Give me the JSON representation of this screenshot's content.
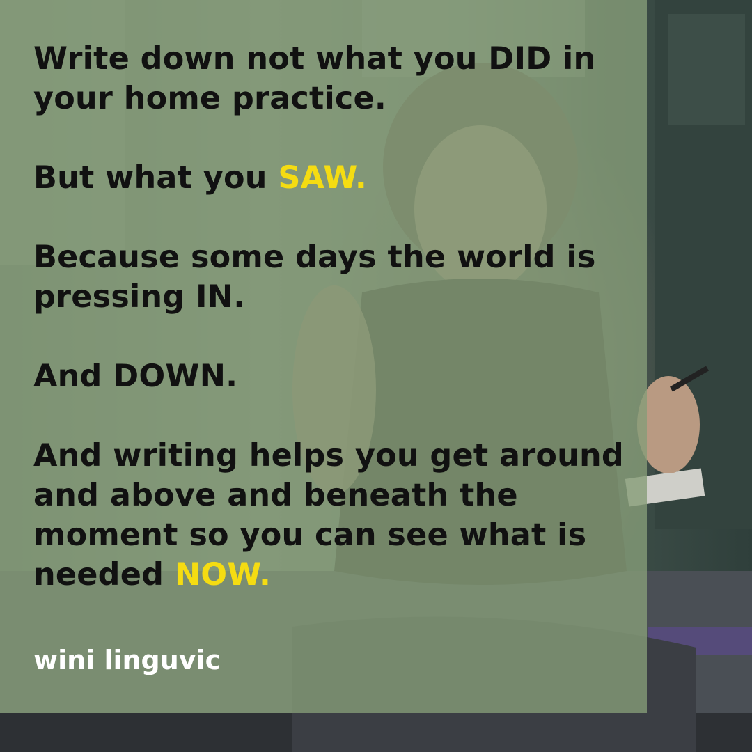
{
  "post": {
    "paragraphs": [
      {
        "lines": [
          "Write down not what you DID in",
          "your home practice."
        ]
      },
      {
        "lead": "But what you ",
        "highlight": "SAW."
      },
      {
        "lines": [
          "Because some days the world is",
          "pressing IN."
        ]
      },
      {
        "lines": [
          "And DOWN."
        ]
      },
      {
        "lines": [
          "And writing helps you get around",
          "and above and beneath the",
          "moment so you can see what is"
        ],
        "last_lead": "needed ",
        "highlight": "NOW."
      }
    ],
    "author": "wini linguvic"
  },
  "colors": {
    "highlight": "#f5dc12",
    "text": "#111111",
    "author": "#ffffff",
    "overlay": "#869c78"
  },
  "icons": {
    "background": "photo-yoga-writing"
  }
}
